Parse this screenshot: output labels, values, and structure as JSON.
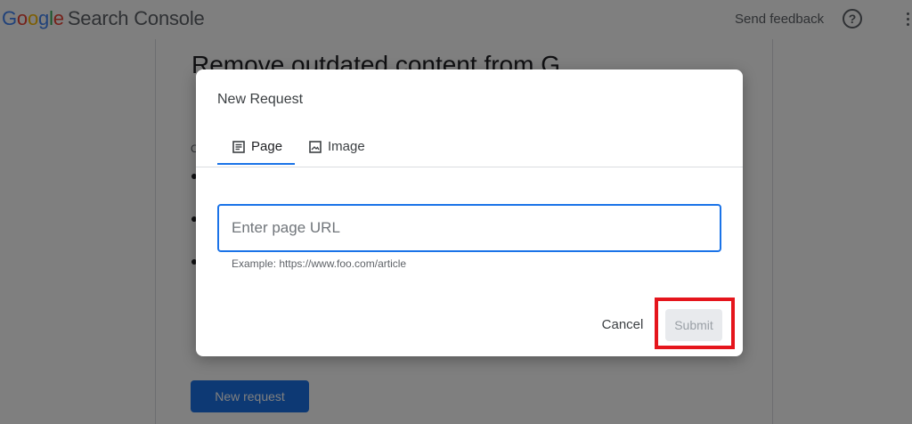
{
  "header": {
    "brand_google": [
      "G",
      "o",
      "o",
      "g",
      "l",
      "e"
    ],
    "product": "Search Console",
    "send_feedback": "Send feedback",
    "help_icon": "help-circle-icon",
    "menu_icon": "more-vertical-icon"
  },
  "background": {
    "heading": "Remove outdated content from G",
    "text_fragment": "C",
    "new_request_label": "New request"
  },
  "dialog": {
    "title": "New Request",
    "tabs": [
      {
        "label": "Page",
        "icon": "page-icon",
        "active": true
      },
      {
        "label": "Image",
        "icon": "image-icon",
        "active": false
      }
    ],
    "url_placeholder": "Enter page URL",
    "url_value": "",
    "hint": "Example: https://www.foo.com/article",
    "cancel_label": "Cancel",
    "submit_label": "Submit",
    "submit_disabled": true
  },
  "colors": {
    "accent": "#1a73e8",
    "highlight": "#e5151c",
    "scrim": "rgba(0,0,0,0.5)"
  }
}
